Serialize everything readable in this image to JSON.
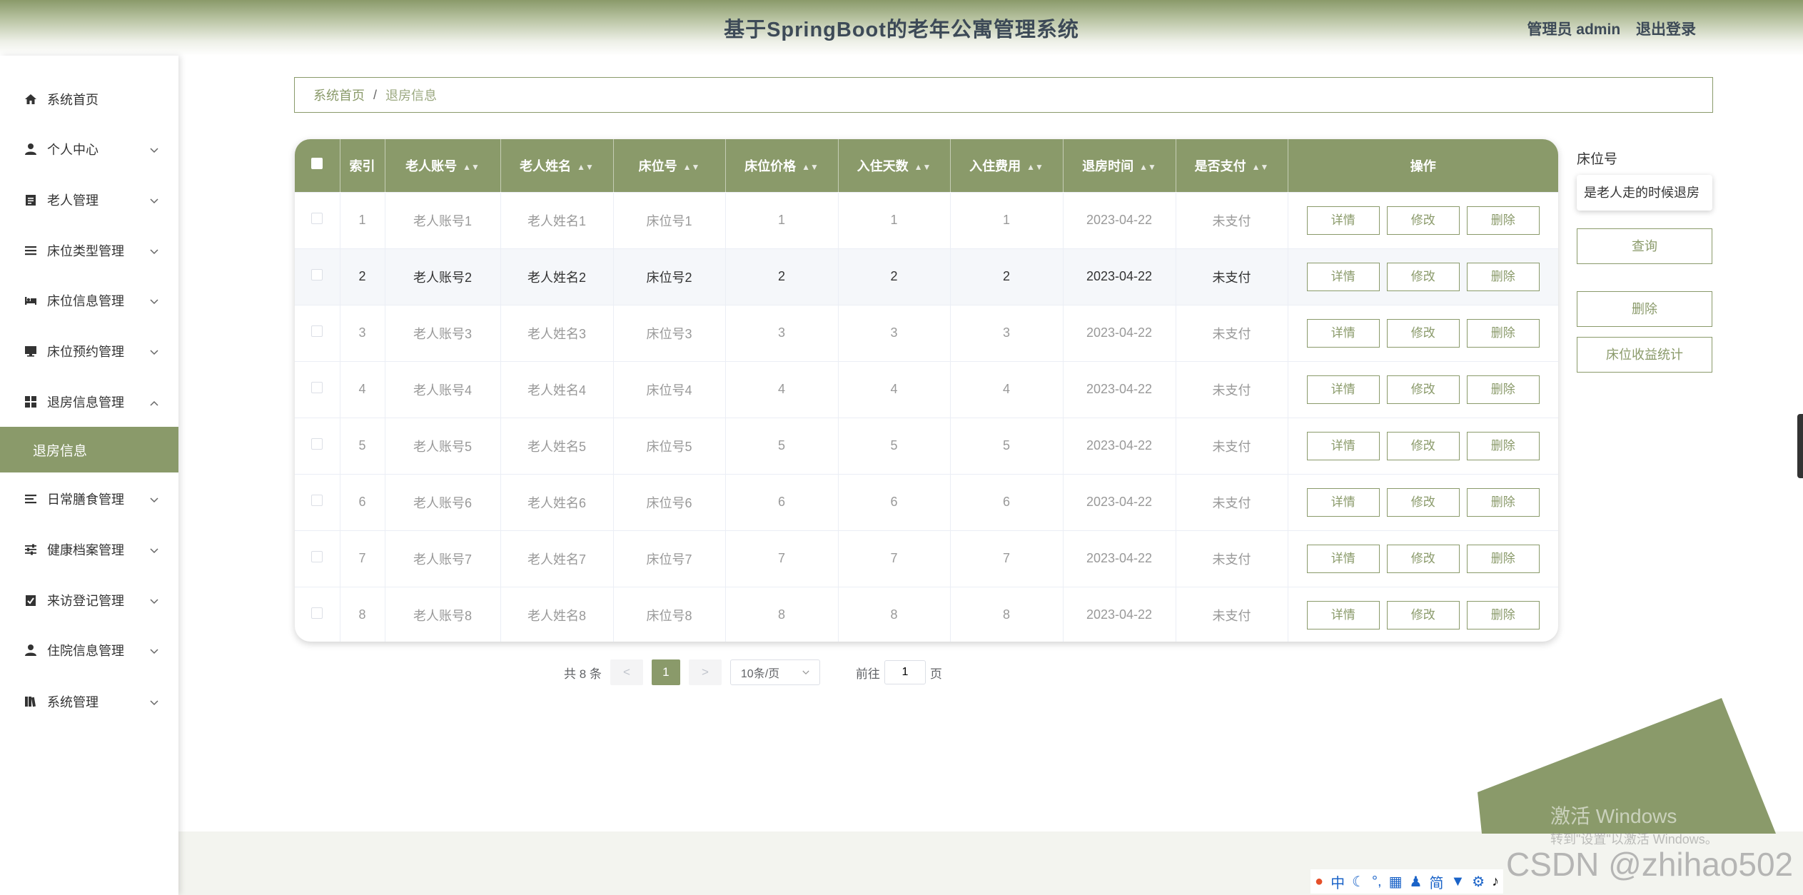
{
  "header": {
    "title": "基于SpringBoot的老年公寓管理系统",
    "user": "管理员 admin",
    "logout": "退出登录"
  },
  "sidebar": {
    "items": [
      {
        "label": "系统首页",
        "icon": "home-icon"
      },
      {
        "label": "个人中心",
        "icon": "user-icon"
      },
      {
        "label": "老人管理",
        "icon": "clipboard-icon"
      },
      {
        "label": "床位类型管理",
        "icon": "list-icon"
      },
      {
        "label": "床位信息管理",
        "icon": "bed-icon"
      },
      {
        "label": "床位预约管理",
        "icon": "monitor-icon"
      },
      {
        "label": "退房信息管理",
        "icon": "grid-icon"
      },
      {
        "label": "日常膳食管理",
        "icon": "list-icon"
      },
      {
        "label": "健康档案管理",
        "icon": "sliders-icon"
      },
      {
        "label": "来访登记管理",
        "icon": "check-clipboard-icon"
      },
      {
        "label": "住院信息管理",
        "icon": "user-icon"
      },
      {
        "label": "系统管理",
        "icon": "book-icon"
      }
    ],
    "active_sub": "退房信息"
  },
  "breadcrumb": {
    "home": "系统首页",
    "sep": "/",
    "current": "退房信息"
  },
  "table": {
    "headers": [
      "索引",
      "老人账号",
      "老人姓名",
      "床位号",
      "床位价格",
      "入住天数",
      "入住费用",
      "退房时间",
      "是否支付",
      "操作"
    ],
    "rows": [
      {
        "index": "1",
        "account": "老人账号1",
        "name": "老人姓名1",
        "bed": "床位号1",
        "price": "1",
        "days": "1",
        "fee": "1",
        "time": "2023-04-22",
        "paid": "未支付"
      },
      {
        "index": "2",
        "account": "老人账号2",
        "name": "老人姓名2",
        "bed": "床位号2",
        "price": "2",
        "days": "2",
        "fee": "2",
        "time": "2023-04-22",
        "paid": "未支付"
      },
      {
        "index": "3",
        "account": "老人账号3",
        "name": "老人姓名3",
        "bed": "床位号3",
        "price": "3",
        "days": "3",
        "fee": "3",
        "time": "2023-04-22",
        "paid": "未支付"
      },
      {
        "index": "4",
        "account": "老人账号4",
        "name": "老人姓名4",
        "bed": "床位号4",
        "price": "4",
        "days": "4",
        "fee": "4",
        "time": "2023-04-22",
        "paid": "未支付"
      },
      {
        "index": "5",
        "account": "老人账号5",
        "name": "老人姓名5",
        "bed": "床位号5",
        "price": "5",
        "days": "5",
        "fee": "5",
        "time": "2023-04-22",
        "paid": "未支付"
      },
      {
        "index": "6",
        "account": "老人账号6",
        "name": "老人姓名6",
        "bed": "床位号6",
        "price": "6",
        "days": "6",
        "fee": "6",
        "time": "2023-04-22",
        "paid": "未支付"
      },
      {
        "index": "7",
        "account": "老人账号7",
        "name": "老人姓名7",
        "bed": "床位号7",
        "price": "7",
        "days": "7",
        "fee": "7",
        "time": "2023-04-22",
        "paid": "未支付"
      },
      {
        "index": "8",
        "account": "老人账号8",
        "name": "老人姓名8",
        "bed": "床位号8",
        "price": "8",
        "days": "8",
        "fee": "8",
        "time": "2023-04-22",
        "paid": "未支付"
      }
    ],
    "actions": {
      "detail": "详情",
      "edit": "修改",
      "delete": "删除"
    },
    "highlighted_row": 2
  },
  "pagination": {
    "total": "共 8 条",
    "prev": "<",
    "current": "1",
    "next": ">",
    "page_size": "10条/页",
    "goto_label": "前往",
    "goto_value": "1",
    "page_suffix": "页"
  },
  "right_panel": {
    "label": "床位号",
    "input_value": "是老人走的时候退房",
    "search": "查询",
    "delete": "删除",
    "stats": "床位收益统计"
  },
  "overlay": {
    "windows_activate": "激活 Windows",
    "windows_hint": "转到\"设置\"以激活 Windows。",
    "csdn": "CSDN @zhihao502"
  },
  "tray": {
    "ime": "中",
    "simplified": "简"
  },
  "colors": {
    "accent": "#8a9a6a",
    "title": "#3d4a57"
  }
}
